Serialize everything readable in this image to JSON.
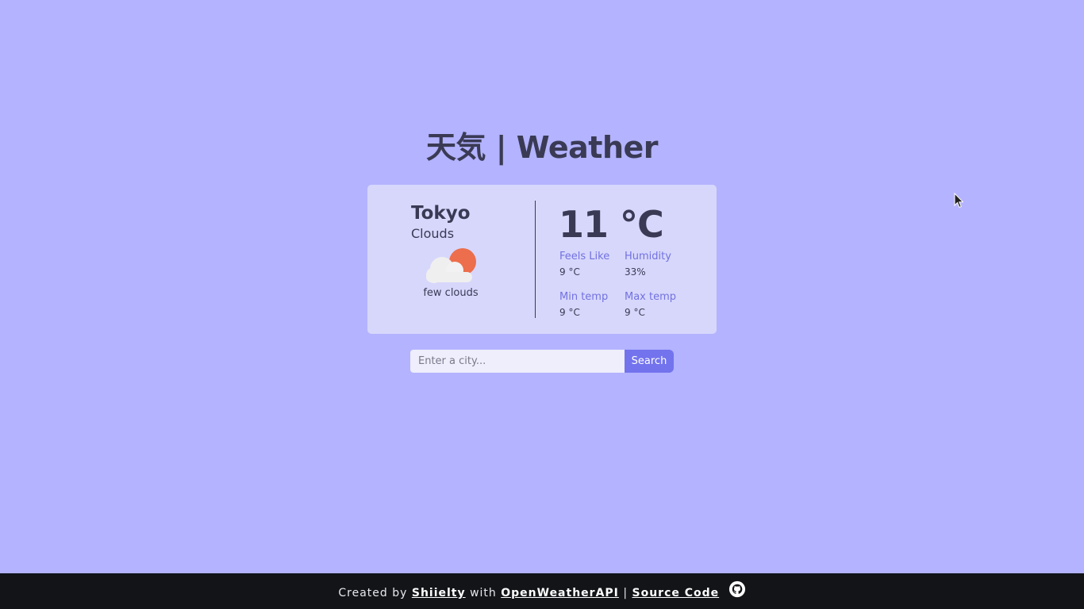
{
  "page": {
    "title": "天気 | Weather"
  },
  "weather": {
    "city": "Tokyo",
    "condition": "Clouds",
    "description": "few clouds",
    "icon": "few-clouds-icon",
    "temperature": "11 °C",
    "feels_like_label": "Feels Like",
    "feels_like_value": "9 °C",
    "humidity_label": "Humidity",
    "humidity_value": "33%",
    "min_temp_label": "Min temp",
    "min_temp_value": "9 °C",
    "max_temp_label": "Max temp",
    "max_temp_value": "9 °C"
  },
  "search": {
    "placeholder": "Enter a city...",
    "value": "",
    "button_label": "Search"
  },
  "footer": {
    "created_by": "Created by",
    "author_link": "Shiielty",
    "with": "with",
    "api_link": "OpenWeatherAPI",
    "separator": "|",
    "source_link": "Source Code",
    "icon": "github-icon"
  },
  "colors": {
    "background": "#b3b3ff",
    "card": "#d7d7fc",
    "accent": "#7373ee",
    "label": "#7272e0",
    "text": "#3a3a55",
    "footer": "#121418"
  }
}
